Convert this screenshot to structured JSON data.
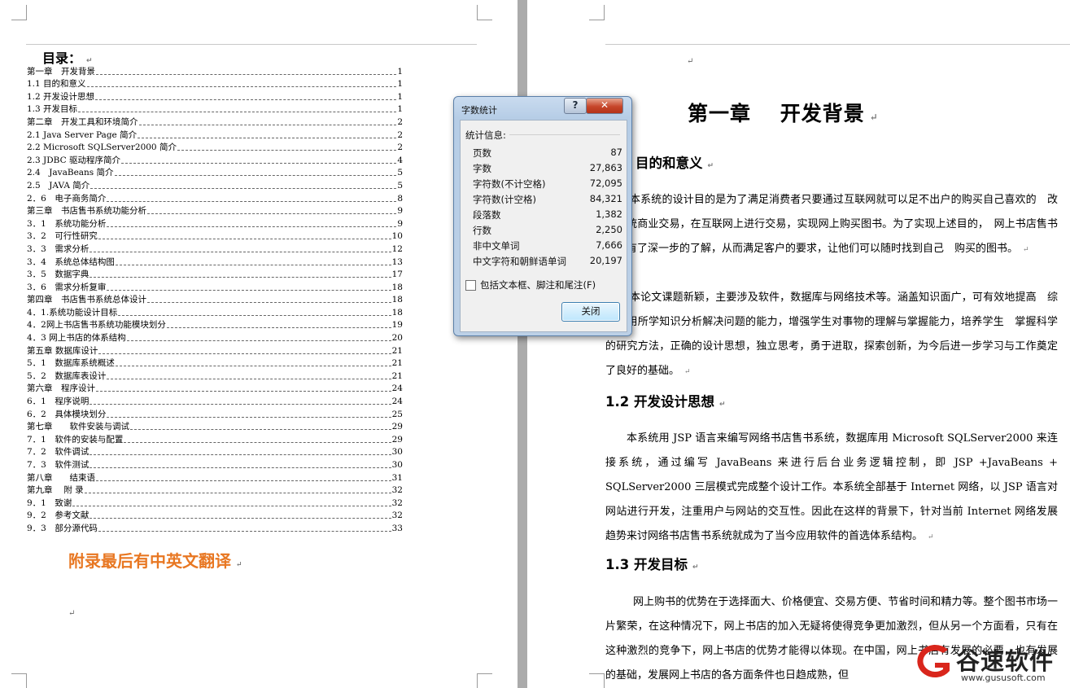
{
  "toc": {
    "title": "目录：",
    "entries": [
      {
        "text": "第一章　开发背景",
        "page": "1"
      },
      {
        "text": "1.1 目的和意义",
        "page": "1"
      },
      {
        "text": "1.2 开发设计思想",
        "page": "1"
      },
      {
        "text": "1.3 开发目标",
        "page": "1"
      },
      {
        "text": "第二章　开发工具和环境简介",
        "page": "2"
      },
      {
        "text": "2.1 Java Server Page 简介",
        "page": "2"
      },
      {
        "text": "2.2 Microsoft SQLServer2000 简介",
        "page": "2"
      },
      {
        "text": "2.3 JDBC 驱动程序简介",
        "page": "4"
      },
      {
        "text": "2.4　JavaBeans 简介",
        "page": "5"
      },
      {
        "text": "2.5　JAVA 简介",
        "page": "5"
      },
      {
        "text": "2．6　电子商务简介",
        "page": "8"
      },
      {
        "text": "第三章　书店售书系统功能分析",
        "page": "9"
      },
      {
        "text": "3．1　系统功能分析",
        "page": "9"
      },
      {
        "text": "3．2　可行性研究",
        "page": "10"
      },
      {
        "text": "3．3　需求分析",
        "page": "12"
      },
      {
        "text": "3．4　系统总体结构图",
        "page": "13"
      },
      {
        "text": "3．5　数据字典",
        "page": "17"
      },
      {
        "text": "3．6　需求分析复审",
        "page": "18"
      },
      {
        "text": "第四章　书店售书系统总体设计",
        "page": "18"
      },
      {
        "text": "4．1.系统功能设计目标",
        "page": "18"
      },
      {
        "text": "4．2网上书店售书系统功能模块划分",
        "page": "19"
      },
      {
        "text": "4．3 网上书店的体系结构",
        "page": "20"
      },
      {
        "text": "第五章 数据库设计",
        "page": "21"
      },
      {
        "text": "5．1　数据库系统概述",
        "page": "21"
      },
      {
        "text": "5．2　数据库表设计",
        "page": "21"
      },
      {
        "text": "第六章　程序设计",
        "page": "24"
      },
      {
        "text": "6．1　程序说明",
        "page": "24"
      },
      {
        "text": "6．2　具体模块划分",
        "page": "25"
      },
      {
        "text": "第七章　　软件安装与调试",
        "page": "29"
      },
      {
        "text": "7．1　软件的安装与配置",
        "page": "29"
      },
      {
        "text": "7．2　软件调试",
        "page": "30"
      },
      {
        "text": "7．3　软件测试",
        "page": "30"
      },
      {
        "text": "第八章　　结束语",
        "page": "31"
      },
      {
        "text": "第九章　 附 录",
        "page": "32"
      },
      {
        "text": "9．1　致谢",
        "page": "32"
      },
      {
        "text": "9．2　参考文献",
        "page": "32"
      },
      {
        "text": "9．3　部分源代码",
        "page": "33"
      }
    ],
    "appendix_note": "附录最后有中英文翻译"
  },
  "doc": {
    "chapter_title": "第一章　 开发背景",
    "h_1_1": "目的和意义",
    "p1": "本系统的设计目的是为了满足消费者只要通过互联网就可以足不出户的购买自己喜欢的　改变传统商业交易，在互联网上进行交易，实现网上购买图书。为了实现上述目的，　网上书店售书系统有了深一步的了解，从而满足客户的要求，让他们可以随时找到自己　购买的图书。",
    "p2": "本论文课题新颖，主要涉及软件，数据库与网络技术等。涵盖知识面广，可有效地提高　综合运用所学知识分析解决问题的能力，增强学生对事物的理解与掌握能力，培养学生　掌握科学的研究方法，正确的设计思想，独立思考，勇于进取，探索创新，为今后进一步学习与工作奠定了良好的基础。",
    "h_1_2": "1.2  开发设计思想",
    "p3": "本系统用 JSP 语言来编写网络书店售书系统，数据库用 Microsoft SQLServer2000 来连接系统，通过编写 JavaBeans 来进行后台业务逻辑控制，即 JSP +JavaBeans + SQLServer2000 三层模式完成整个设计工作。本系统全部基于 Internet 网络，以 JSP 语言对网站进行开发，注重用户与网站的交互性。因此在这样的背景下，针对当前 Internet 网络发展趋势来讨网络书店售书系统就成为了当今应用软件的首选体系结构。",
    "h_1_3": "1.3  开发目标",
    "p4": "网上购书的优势在于选择面大、价格便宜、交易方便、节省时间和精力等。整个图书市场一片繁荣，在这种情况下，网上书店的加入无疑将使得竞争更加激烈，但从另一个方面看，只有在这种激烈的竞争下，网上书店的优势才能得以体现。在中国，网上书店有发展的必要，也有发展的基础，发展网上书店的各方面条件也日趋成熟，但"
  },
  "dialog": {
    "title": "字数统计",
    "help_label": "?",
    "close_x": "✕",
    "section_label": "统计信息:",
    "stats": [
      {
        "label": "页数",
        "value": "87"
      },
      {
        "label": "字数",
        "value": "27,863"
      },
      {
        "label": "字符数(不计空格)",
        "value": "72,095"
      },
      {
        "label": "字符数(计空格)",
        "value": "84,321"
      },
      {
        "label": "段落数",
        "value": "1,382"
      },
      {
        "label": "行数",
        "value": "2,250"
      },
      {
        "label": "非中文单词",
        "value": "7,666"
      },
      {
        "label": "中文字符和朝鲜语单词",
        "value": "20,197"
      }
    ],
    "checkbox_label": "包括文本框、脚注和尾注(F)",
    "close_button": "关闭"
  },
  "watermark": {
    "brand": "谷速软件",
    "url": "www.gususoft.com"
  },
  "colors": {
    "appendix_note": "#e87722",
    "gutter": "#ababab",
    "dialog_frame": "#bcd0e6"
  }
}
